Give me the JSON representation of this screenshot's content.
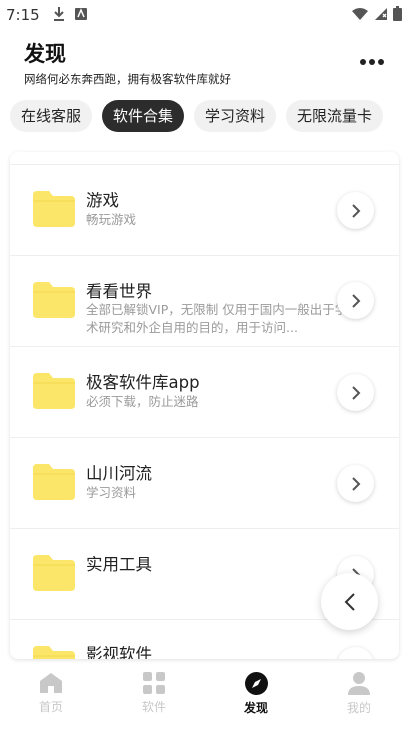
{
  "status_bar": {
    "time": "7:15"
  },
  "header": {
    "title": "发现",
    "subtitle": "网络何必东奔西跑，拥有极客软件库就好"
  },
  "tabs": [
    {
      "label": "在线客服",
      "active": false
    },
    {
      "label": "软件合集",
      "active": true
    },
    {
      "label": "学习资料",
      "active": false
    },
    {
      "label": "无限流量卡",
      "active": false
    }
  ],
  "list": [
    {
      "title": "游戏",
      "desc": "畅玩游戏"
    },
    {
      "title": "看看世界",
      "desc": "全部已解锁VIP，无限制 仅用于国内一般出于学术研究和外企自用的目的，用于访问..."
    },
    {
      "title": "极客软件库app",
      "desc": "必须下载，防止迷路"
    },
    {
      "title": "山川河流",
      "desc": "学习资料"
    },
    {
      "title": "实用工具",
      "desc": ""
    },
    {
      "title": "影视软件",
      "desc": ""
    }
  ],
  "bottom_nav": [
    {
      "label": "首页",
      "icon": "home-icon",
      "active": false
    },
    {
      "label": "软件",
      "icon": "grid-icon",
      "active": false
    },
    {
      "label": "发现",
      "icon": "compass-icon",
      "active": true
    },
    {
      "label": "我的",
      "icon": "person-icon",
      "active": false
    }
  ],
  "colors": {
    "folder": "#FCE66A",
    "active_tab": "#2C2C2C",
    "inactive_nav": "#C8C8C8"
  }
}
